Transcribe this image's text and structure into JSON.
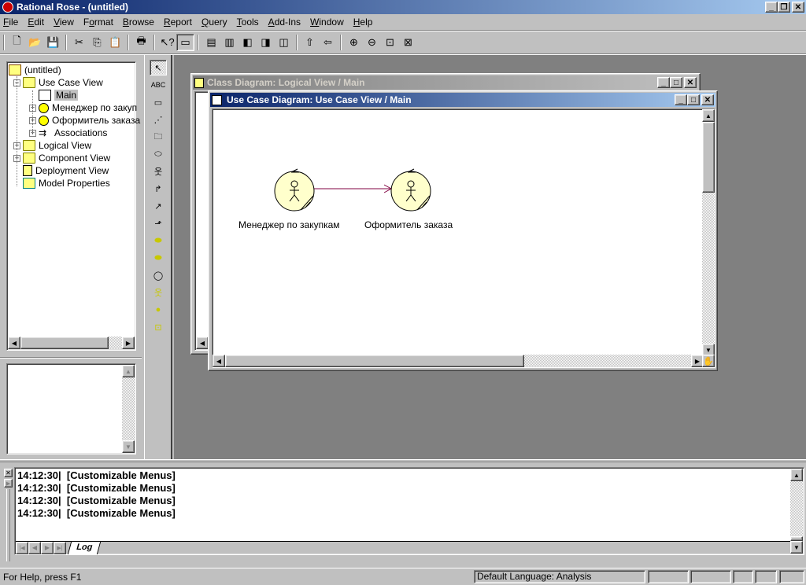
{
  "app": {
    "title": "Rational Rose - (untitled)",
    "window_controls": {
      "minimize": "_",
      "restore": "❐",
      "close": "✕"
    }
  },
  "menu": [
    {
      "label": "File",
      "accel": "F"
    },
    {
      "label": "Edit",
      "accel": "E"
    },
    {
      "label": "View",
      "accel": "V"
    },
    {
      "label": "Format",
      "accel": "o"
    },
    {
      "label": "Browse",
      "accel": "B"
    },
    {
      "label": "Report",
      "accel": "R"
    },
    {
      "label": "Query",
      "accel": "Q"
    },
    {
      "label": "Tools",
      "accel": "T"
    },
    {
      "label": "Add-Ins",
      "accel": "A"
    },
    {
      "label": "Window",
      "accel": "W"
    },
    {
      "label": "Help",
      "accel": "H"
    }
  ],
  "toolbar": [
    {
      "icon": "new-file-icon",
      "glyph": "🗋"
    },
    {
      "icon": "open-folder-icon",
      "glyph": "📂"
    },
    {
      "icon": "save-icon",
      "glyph": "💾"
    },
    {
      "sep": true
    },
    {
      "icon": "cut-icon",
      "glyph": "✂"
    },
    {
      "icon": "copy-icon",
      "glyph": "⎘"
    },
    {
      "icon": "paste-icon",
      "glyph": "📋"
    },
    {
      "sep": true
    },
    {
      "icon": "print-icon",
      "glyph": "🖶"
    },
    {
      "sep": true
    },
    {
      "icon": "context-help-icon",
      "glyph": "↖?"
    },
    {
      "icon": "browser-view-icon",
      "glyph": "▭"
    },
    {
      "sep": true
    },
    {
      "icon": "class-diagram-icon",
      "glyph": "▤"
    },
    {
      "icon": "interaction-diagram-icon",
      "glyph": "▥"
    },
    {
      "icon": "component-diagram-icon",
      "glyph": "◧"
    },
    {
      "icon": "statechart-diagram-icon",
      "glyph": "◨"
    },
    {
      "icon": "deployment-diagram-icon",
      "glyph": "◫"
    },
    {
      "sep": true
    },
    {
      "icon": "parent-diagram-icon",
      "glyph": "⇧"
    },
    {
      "icon": "previous-diagram-icon",
      "glyph": "⇦"
    },
    {
      "sep": true
    },
    {
      "icon": "zoom-in-icon",
      "glyph": "⊕"
    },
    {
      "icon": "zoom-out-icon",
      "glyph": "⊖"
    },
    {
      "icon": "fit-in-window-icon",
      "glyph": "⊡"
    },
    {
      "icon": "undo-fit-icon",
      "glyph": "⊠"
    }
  ],
  "browser": {
    "root": "(untitled)",
    "items": [
      {
        "label": "Use Case View",
        "icon": "folder-icon",
        "expander": "−"
      },
      {
        "label": "Main",
        "icon": "use-case-diagram-icon",
        "selected": true
      },
      {
        "label": "Менеджер по закуп",
        "icon": "actor-icon",
        "expander": "+"
      },
      {
        "label": "Оформитель заказа",
        "icon": "actor-icon",
        "expander": "+"
      },
      {
        "label": "Associations",
        "icon": "associations-icon",
        "expander": "+"
      },
      {
        "label": "Logical View",
        "icon": "folder-icon",
        "expander": "+"
      },
      {
        "label": "Component View",
        "icon": "folder-icon",
        "expander": "+"
      },
      {
        "label": "Deployment View",
        "icon": "deployment-icon"
      },
      {
        "label": "Model Properties",
        "icon": "model-properties-icon"
      }
    ]
  },
  "toolbox": [
    {
      "name": "selection-tool",
      "glyph": "↖"
    },
    {
      "name": "text-tool",
      "glyph": "ABC"
    },
    {
      "name": "note-tool",
      "glyph": "▭"
    },
    {
      "name": "anchor-note-tool",
      "glyph": "⋰"
    },
    {
      "name": "package-tool",
      "glyph": "🗀"
    },
    {
      "name": "use-case-tool",
      "glyph": "⬭"
    },
    {
      "name": "actor-tool",
      "glyph": "웃"
    },
    {
      "name": "unidirectional-association-tool",
      "glyph": "↱"
    },
    {
      "name": "dependency-tool",
      "glyph": "↗"
    },
    {
      "name": "generalization-tool",
      "glyph": "⬏"
    },
    {
      "name": "business-use-case-tool",
      "glyph": "⬬"
    },
    {
      "name": "business-use-case-realization-tool",
      "glyph": "⬬"
    },
    {
      "name": "business-entity-tool",
      "glyph": "◯"
    },
    {
      "name": "business-actor-tool",
      "glyph": "웃"
    },
    {
      "name": "business-worker-tool",
      "glyph": "●"
    },
    {
      "name": "organization-unit-tool",
      "glyph": "⊡"
    }
  ],
  "class_window": {
    "title": "Class Diagram: Logical View / Main"
  },
  "usecase_window": {
    "title": "Use Case Diagram: Use Case View / Main",
    "actors": [
      {
        "name": "Менеджер по закупкам"
      },
      {
        "name": "Оформитель заказа"
      }
    ],
    "association": {
      "from": 0,
      "to": 1,
      "color": "#800040"
    }
  },
  "log": {
    "lines": [
      {
        "time": "14:12:30|",
        "text": "[Customizable Menus]"
      },
      {
        "time": "14:12:30|",
        "text": "[Customizable Menus]"
      },
      {
        "time": "14:12:30|",
        "text": "[Customizable Menus]"
      },
      {
        "time": "14:12:30|",
        "text": "[Customizable Menus]"
      }
    ],
    "tab": "Log"
  },
  "statusbar": {
    "help": "For Help, press F1",
    "language": "Default Language: Analysis"
  },
  "colors": {
    "title_active": "#0a246a",
    "actor_fill": "#ffffcc",
    "mdi_bg": "#808080"
  }
}
